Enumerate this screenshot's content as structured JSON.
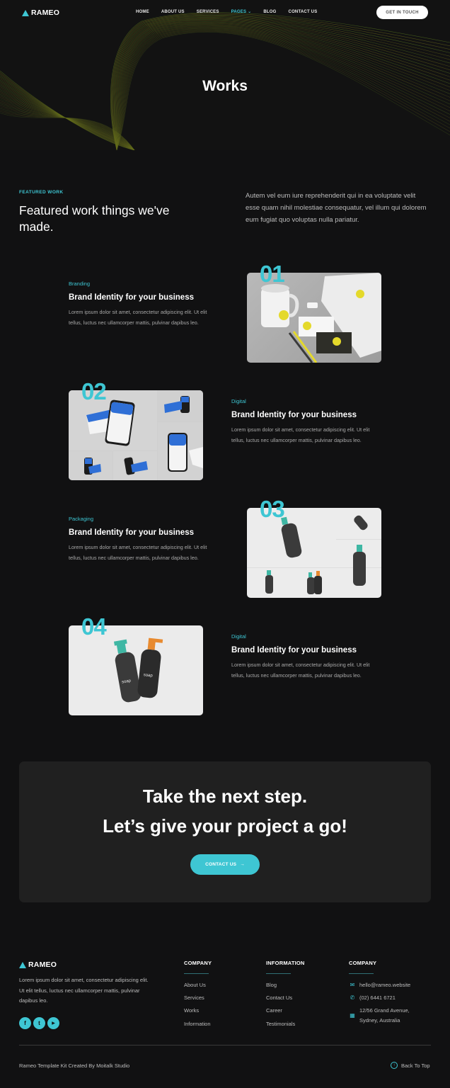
{
  "header": {
    "logo": "RAMEO",
    "nav": [
      {
        "label": "HOME",
        "active": false
      },
      {
        "label": "ABOUT US",
        "active": false
      },
      {
        "label": "SERVICES",
        "active": false
      },
      {
        "label": "PAGES",
        "active": true,
        "dropdown": true
      },
      {
        "label": "BLOG",
        "active": false
      },
      {
        "label": "CONTACT US",
        "active": false
      }
    ],
    "cta_label": "GET IN TOUCH"
  },
  "hero": {
    "title": "Works"
  },
  "featured": {
    "eyebrow": "FEATURED WORK",
    "title": "Featured work things we've made.",
    "text": "Autem vel eum iure reprehenderit qui in ea voluptate velit esse quam nihil molestiae consequatur, vel illum qui dolorem eum fugiat quo voluptas nulla pariatur."
  },
  "works": [
    {
      "number": "01",
      "category": "Branding",
      "title": "Brand Identity for your business",
      "description": "Lorem ipsum dolor sit amet, consectetur adipiscing elit. Ut elit tellus, luctus nec ullamcorper mattis, pulvinar dapibus leo.",
      "image": "stationery-branding-mockup"
    },
    {
      "number": "02",
      "category": "Digital",
      "title": "Brand Identity for your business",
      "description": "Lorem ipsum dolor sit amet, consectetur adipiscing elit. Ut elit tellus, luctus nec ullamcorper mattis, pulvinar dapibus leo.",
      "image": "phone-card-app-mockup"
    },
    {
      "number": "03",
      "category": "Packaging",
      "title": "Brand Identity for your business",
      "description": "Lorem ipsum dolor sit amet, consectetur adipiscing elit. Ut elit tellus, luctus nec ullamcorper mattis, pulvinar dapibus leo.",
      "image": "soap-bottle-grid-mockup"
    },
    {
      "number": "04",
      "category": "Digital",
      "title": "Brand Identity for your business",
      "description": "Lorem ipsum dolor sit amet, consectetur adipiscing elit. Ut elit tellus, luctus nec ullamcorper mattis, pulvinar dapibus leo.",
      "image": "soap-dispenser-bottles-mockup"
    }
  ],
  "cta": {
    "line1": "Take the next step.",
    "line2": "Let’s give your project a go!",
    "button": "CONTACT US",
    "button_icon": "→"
  },
  "footer": {
    "logo": "RAMEO",
    "about": "Lorem ipsum dolor sit amet, consectetur adipiscing elit. Ut elit tellus, luctus nec ullamcorper mattis, pulvinar dapibus leo.",
    "socials": [
      {
        "name": "facebook",
        "glyph": "f"
      },
      {
        "name": "twitter",
        "glyph": "t"
      },
      {
        "name": "youtube",
        "glyph": "▶"
      }
    ],
    "col1": {
      "heading": "COMPANY",
      "links": [
        "About Us",
        "Services",
        "Works",
        "Information"
      ]
    },
    "col2": {
      "heading": "INFORMATION",
      "links": [
        "Blog",
        "Contact Us",
        "Career",
        "Testimonials"
      ]
    },
    "col3": {
      "heading": "COMPANY",
      "email": "hello@rameo.website",
      "phone": "(02) 6441 6721",
      "address": "12/56 Grand Avenue, Sydney, Australia"
    },
    "copyright": "Rameo Template Kit Created By Moitalk Studio",
    "back_to_top": "Back To Top"
  },
  "colors": {
    "accent": "#3ec6d3",
    "background": "#111112",
    "cta_panel": "#202020"
  }
}
